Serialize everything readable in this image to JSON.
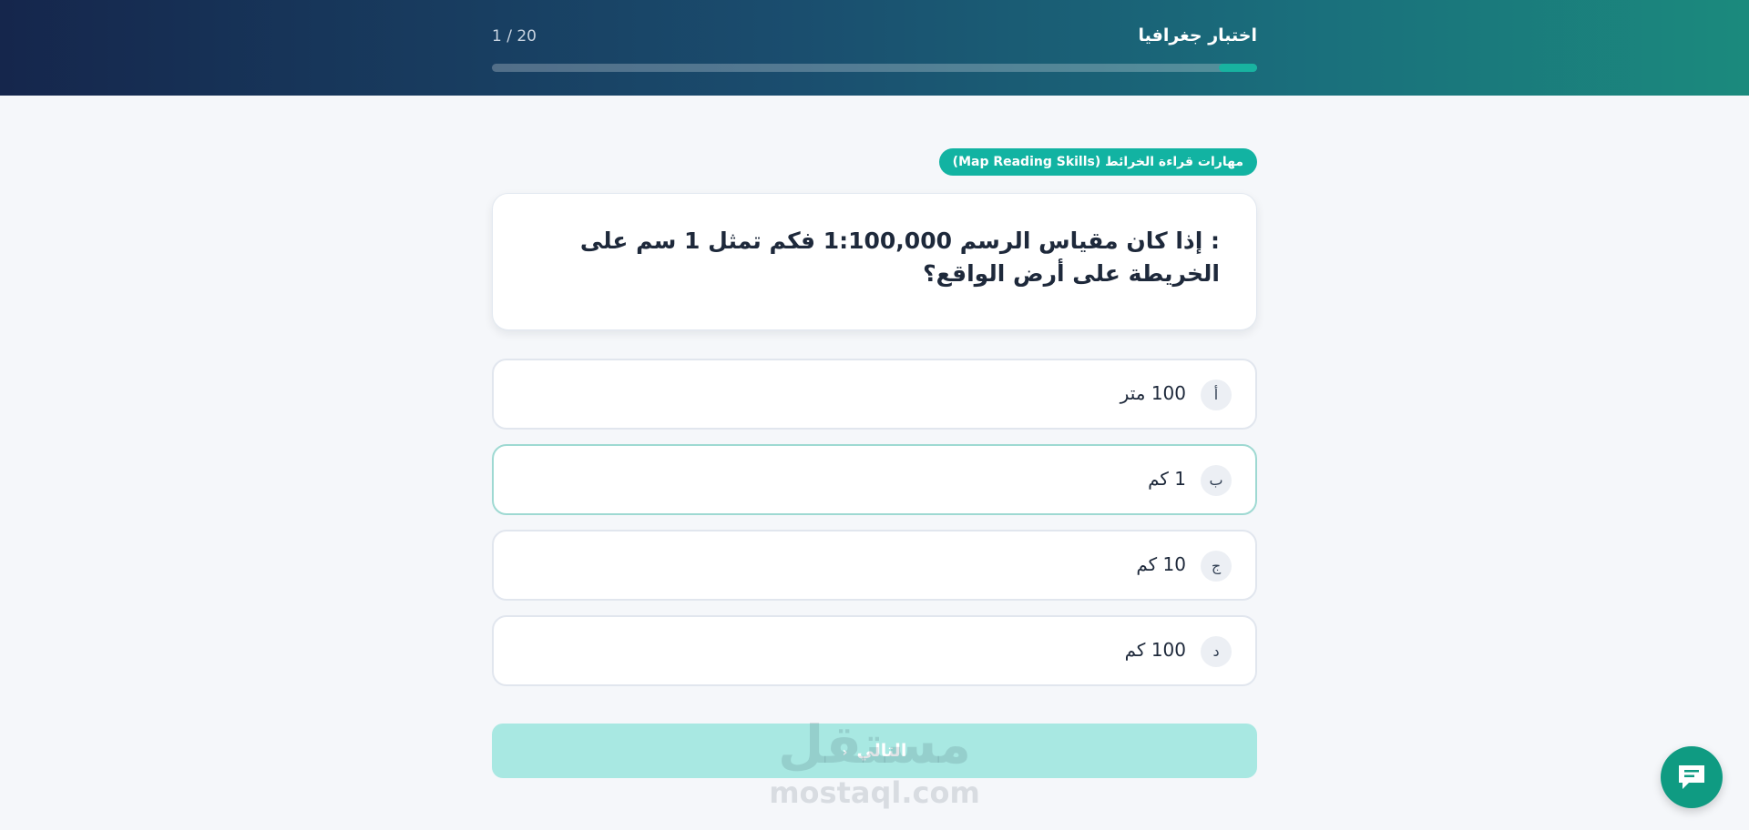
{
  "header": {
    "title": "اختبار جغرافيا",
    "counter": "1 / 20",
    "progress_fraction": 0.05
  },
  "topic": {
    "label": "مهارات قراءة الخرائط (Map Reading Skills)"
  },
  "question": {
    "text": ": إذا كان مقياس الرسم 1:100,000 فكم تمثل 1 سم على الخريطة على أرض الواقع؟"
  },
  "options": [
    {
      "letter": "أ",
      "text": "100 متر",
      "selected": false
    },
    {
      "letter": "ب",
      "text": "1 كم",
      "selected": true
    },
    {
      "letter": "ج",
      "text": "10 كم",
      "selected": false
    },
    {
      "letter": "د",
      "text": "100 كم",
      "selected": false
    }
  ],
  "next_button": {
    "label": "التالي"
  },
  "watermark": {
    "arabic": "مستقل",
    "latin": "mostaql.com"
  },
  "colors": {
    "accent": "#12b3a2",
    "header_start": "#15264c",
    "header_end": "#1b8a7d",
    "chat_button": "#0f9b82"
  },
  "icons": {
    "next_chevron": "chevron-left-icon",
    "chat": "chat-icon"
  }
}
